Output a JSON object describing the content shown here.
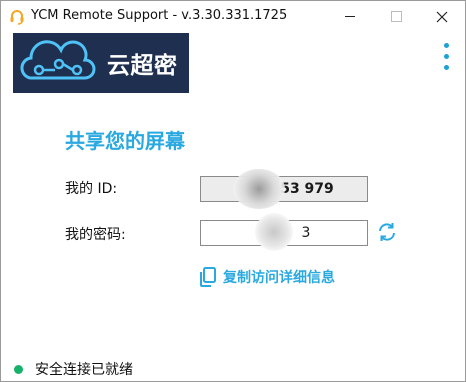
{
  "window": {
    "title": "YCM Remote Support - v.3.30.331.1725",
    "controls": [
      "minimize",
      "maximize",
      "close"
    ]
  },
  "brand": {
    "logo_text": "云超密",
    "logo_bg": "#1f2f4f",
    "icon": "cloud-network-icon"
  },
  "menu": {
    "icon": "kebab-menu-icon"
  },
  "main": {
    "heading": "共享您的屏幕",
    "id_label": "我的 ID:",
    "id_value": "53 979",
    "password_label": "我的密码:",
    "password_value": "3",
    "refresh_icon": "refresh-icon",
    "copy_link": "复制访问详细信息",
    "copy_icon": "copy-icon"
  },
  "status": {
    "text": "安全连接已就绪",
    "color": "#17b26a"
  },
  "colors": {
    "accent": "#2aa9e0"
  }
}
